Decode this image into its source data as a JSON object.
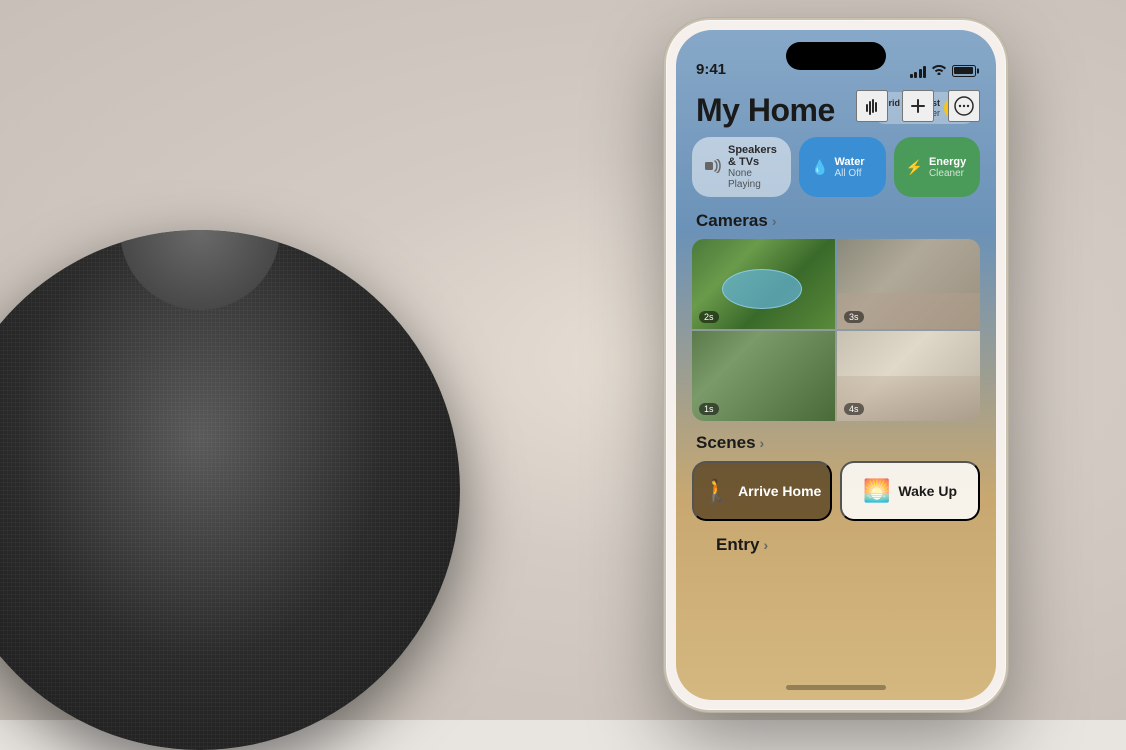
{
  "background": {
    "color": "#e0d8d0"
  },
  "status_bar": {
    "time": "9:41"
  },
  "toolbar": {
    "siri_label": "Siri",
    "add_label": "+",
    "more_label": "···"
  },
  "home_app": {
    "title": "My Home",
    "grid_forecast": {
      "label": "Grid Forecast",
      "sublabel": "Cleaner"
    },
    "pills": [
      {
        "id": "speakers",
        "icon": "🔊",
        "label": "Speakers & TVs",
        "sublabel": "None Playing"
      },
      {
        "id": "water",
        "icon": "💧",
        "label": "Water",
        "sublabel": "All Off"
      },
      {
        "id": "energy",
        "icon": "⚡",
        "label": "Energy",
        "sublabel": "Cleaner"
      }
    ],
    "cameras": {
      "section_label": "Cameras",
      "feeds": [
        {
          "timer": "2s",
          "type": "pool"
        },
        {
          "timer": "3s",
          "type": "room"
        },
        {
          "timer": "1s",
          "type": "garden"
        },
        {
          "timer": "4s",
          "type": "interior"
        }
      ]
    },
    "scenes": {
      "section_label": "Scenes",
      "items": [
        {
          "id": "arrive-home",
          "label": "Arrive Home",
          "icon": "🚶"
        },
        {
          "id": "wake-up",
          "label": "Wake Up",
          "icon": "🌅"
        }
      ]
    },
    "entry": {
      "section_label": "Entry"
    }
  }
}
